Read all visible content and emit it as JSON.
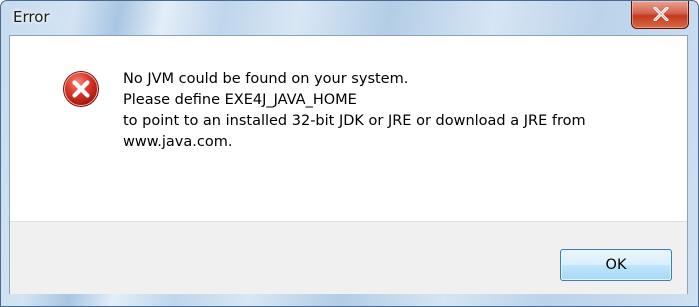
{
  "window": {
    "title": "Error"
  },
  "message": {
    "lines": [
      "No JVM could be found on your system.",
      "Please define EXE4J_JAVA_HOME",
      "to point to an installed 32-bit JDK or JRE or download a JRE from",
      "www.java.com."
    ],
    "icon": "error-icon"
  },
  "buttons": {
    "ok_label": "OK"
  },
  "colors": {
    "close_button": "#c4391f",
    "error_icon": "#c21b1b",
    "ok_border": "#3c7fb1"
  }
}
